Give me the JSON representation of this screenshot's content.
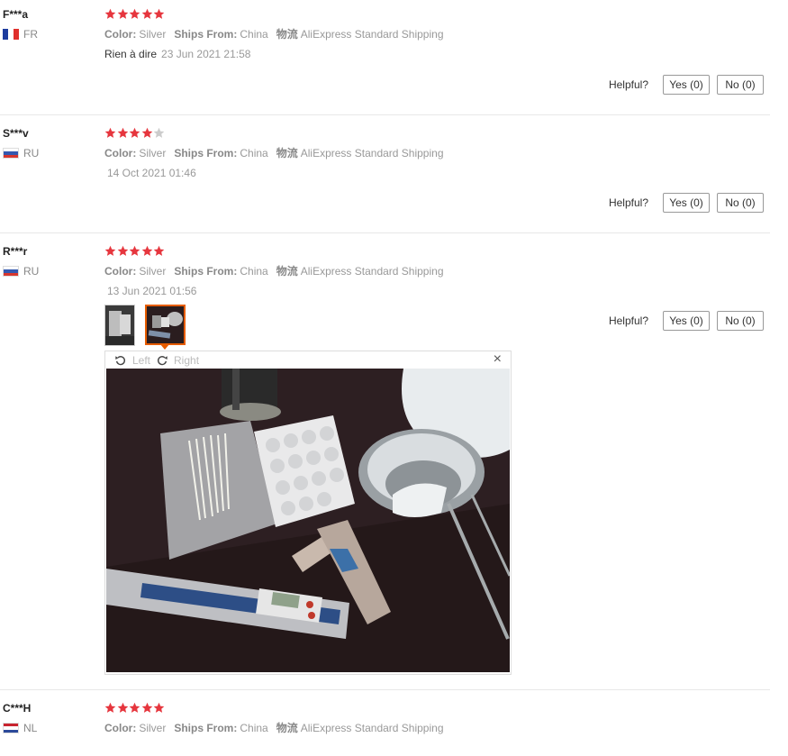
{
  "labels": {
    "color": "Color:",
    "ships_from": "Ships From:",
    "shipping_label": "物流",
    "helpful": "Helpful?"
  },
  "colors": {
    "star_active": "#e6363e",
    "star_inactive": "#cccccc",
    "accent": "#e65c00"
  },
  "reviews": [
    {
      "user": "F***a",
      "country": "FR",
      "rating": 5,
      "color": "Silver",
      "ships_from": "China",
      "shipping": "AliExpress Standard Shipping",
      "text": "Rien à dire",
      "date": "23 Jun 2021 21:58",
      "yes": "Yes (0)",
      "no": "No (0)"
    },
    {
      "user": "S***v",
      "country": "RU",
      "rating": 4,
      "color": "Silver",
      "ships_from": "China",
      "shipping": "AliExpress Standard Shipping",
      "text": "",
      "date": "14 Oct 2021 01:46",
      "yes": "Yes (0)",
      "no": "No (0)"
    },
    {
      "user": "R***r",
      "country": "RU",
      "rating": 5,
      "color": "Silver",
      "ships_from": "China",
      "shipping": "AliExpress Standard Shipping",
      "text": "",
      "date": "13 Jun 2021 01:56",
      "yes": "Yes (0)",
      "no": "No (0)",
      "photo_count": 2,
      "selected_photo": 2
    },
    {
      "user": "C***H",
      "country": "NL",
      "rating": 5,
      "color": "Silver",
      "ships_from": "China",
      "shipping": "AliExpress Standard Shipping"
    }
  ],
  "viewer": {
    "rotate_left": "Left",
    "rotate_right": "Right",
    "close_glyph": "×",
    "icons": [
      "rotate-left-icon",
      "rotate-right-icon",
      "close-icon"
    ]
  }
}
